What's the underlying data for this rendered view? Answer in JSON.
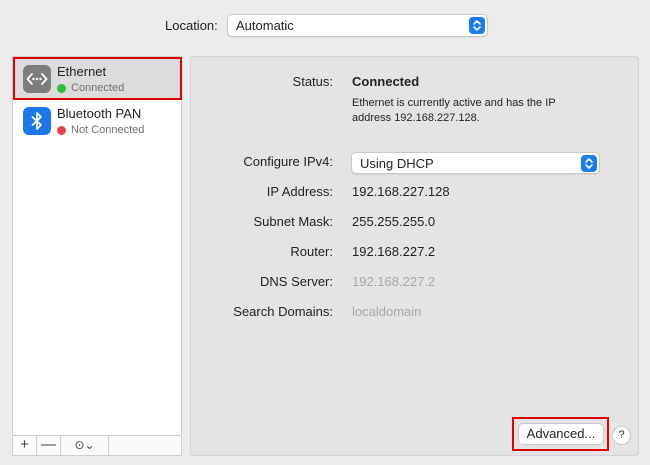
{
  "location": {
    "label": "Location:",
    "value": "Automatic"
  },
  "services": [
    {
      "name": "Ethernet",
      "status": "Connected",
      "status_color": "#2fbf3b",
      "icon": "ethernet-icon",
      "selected": true
    },
    {
      "name": "Bluetooth PAN",
      "status": "Not Connected",
      "status_color": "#e8434a",
      "icon": "bluetooth-icon",
      "selected": false
    }
  ],
  "sidebar_toolbar": {
    "add": "+",
    "remove": "—",
    "action": "⊙⌄"
  },
  "detail": {
    "status_label": "Status:",
    "status_value": "Connected",
    "status_description": "Ethernet is currently active and has the IP address 192.168.227.128.",
    "configure_label": "Configure IPv4:",
    "configure_value": "Using DHCP",
    "ip_label": "IP Address:",
    "ip_value": "192.168.227.128",
    "subnet_label": "Subnet Mask:",
    "subnet_value": "255.255.255.0",
    "router_label": "Router:",
    "router_value": "192.168.227.2",
    "dns_label": "DNS Server:",
    "dns_value": "192.168.227.2",
    "search_label": "Search Domains:",
    "search_value": "localdomain"
  },
  "buttons": {
    "advanced": "Advanced...",
    "help": "?"
  },
  "colors": {
    "accent": "#1a7cf2",
    "highlight": "#e00000"
  }
}
